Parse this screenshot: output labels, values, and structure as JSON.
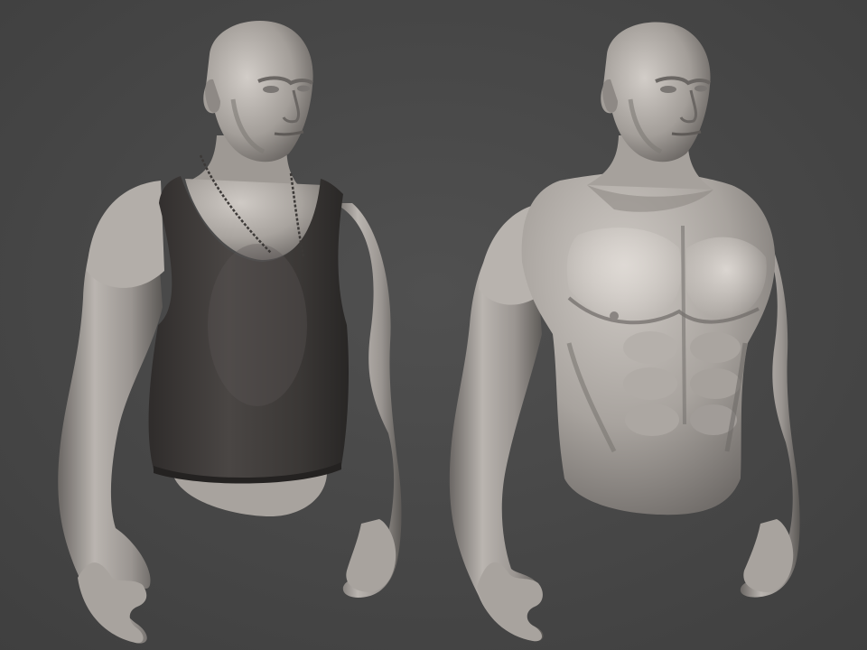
{
  "viewport": {
    "background": "#4a4a4a"
  },
  "figures": [
    {
      "name": "sculpt-clothed-torso",
      "clothing": "tank-top",
      "accessory": "chain-necklace",
      "material": "matcap-gray"
    },
    {
      "name": "sculpt-bare-torso",
      "clothing": "none",
      "material": "matcap-gray"
    }
  ],
  "colors": {
    "skin_light": "#bdb8b3",
    "skin_mid": "#8f8a86",
    "skin_dark": "#4f4c4a",
    "tank_top": "#3a3736",
    "tank_top_highlight": "#55504e"
  }
}
